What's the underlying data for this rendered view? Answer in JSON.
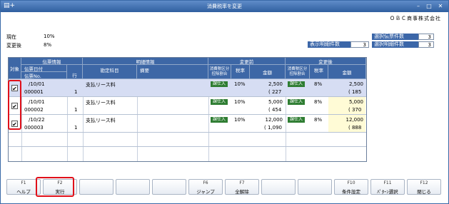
{
  "window": {
    "title": "消費税率を変更",
    "app_icon": "document-plus-icon"
  },
  "company": "ＯＢＣ商事株式会社",
  "rates": {
    "current_label": "現在",
    "current_value": "10%",
    "after_label": "変更後",
    "after_value": "8%"
  },
  "counts": {
    "selected_slips_label": "選択伝票件数",
    "selected_slips_value": "3",
    "display_lines_label": "表示明細件数",
    "display_lines_value": "3",
    "selected_lines_label": "選択明細件数",
    "selected_lines_value": "3"
  },
  "headers": {
    "target": "対象",
    "slip_info": "伝票情報",
    "slip_date": "伝票日付",
    "slip_no": "伝票No.",
    "line_no": "行",
    "detail_info": "明細情報",
    "account": "勘定科目",
    "summary": "摘要",
    "before": "変更前",
    "after": "変更後",
    "tax_cat_before": "消費税区分\n控除割合",
    "rate_before": "税率",
    "amount_before": "金額",
    "tax_cat_after": "消費税区分\n控除割合",
    "rate_after": "税率",
    "amount_after": "金額"
  },
  "rows": [
    {
      "checked": "✔",
      "date": "/10/01",
      "slip_no": "000001",
      "line": "1",
      "account": "支払リース料",
      "summary": "",
      "cat_before": "課仕入",
      "rate_before": "10%",
      "amount_before": "2,500",
      "tax_before": "( 227",
      "cat_after": "課仕入",
      "rate_after": "8%",
      "amount_after": "2,500",
      "tax_after": "( 185",
      "selected": true
    },
    {
      "checked": "✔",
      "date": "/10/01",
      "slip_no": "000002",
      "line": "1",
      "account": "支払リース料",
      "summary": "",
      "cat_before": "課仕入",
      "rate_before": "10%",
      "amount_before": "5,000",
      "tax_before": "( 454",
      "cat_after": "課仕入",
      "rate_after": "8%",
      "amount_after": "5,000",
      "tax_after": "( 370",
      "selected": false
    },
    {
      "checked": "✔",
      "date": "/10/22",
      "slip_no": "000003",
      "line": "1",
      "account": "支払リース料",
      "summary": "",
      "cat_before": "課仕入",
      "rate_before": "10%",
      "amount_before": "12,000",
      "tax_before": "( 1,090",
      "cat_after": "課仕入",
      "rate_after": "8%",
      "amount_after": "12,000",
      "tax_after": "( 888",
      "selected": false
    }
  ],
  "fkeys": [
    {
      "num": "F1",
      "label": "ヘルプ"
    },
    {
      "num": "F2",
      "label": "実行"
    },
    {
      "num": "",
      "label": ""
    },
    {
      "num": "",
      "label": ""
    },
    {
      "num": "",
      "label": ""
    },
    {
      "num": "F6",
      "label": "ジャンプ"
    },
    {
      "num": "F7",
      "label": "全解除"
    },
    {
      "num": "",
      "label": ""
    },
    {
      "num": "",
      "label": ""
    },
    {
      "num": "F10",
      "label": "条件設定"
    },
    {
      "num": "F11",
      "label": "ﾊﾟﾀｰﾝ選択"
    },
    {
      "num": "F12",
      "label": "閉じる"
    }
  ],
  "colors": {
    "header_bg": "#3d67a6",
    "selected_row": "#d6ddf3",
    "badge": "#2e7d32",
    "highlight": "#e0101a"
  }
}
